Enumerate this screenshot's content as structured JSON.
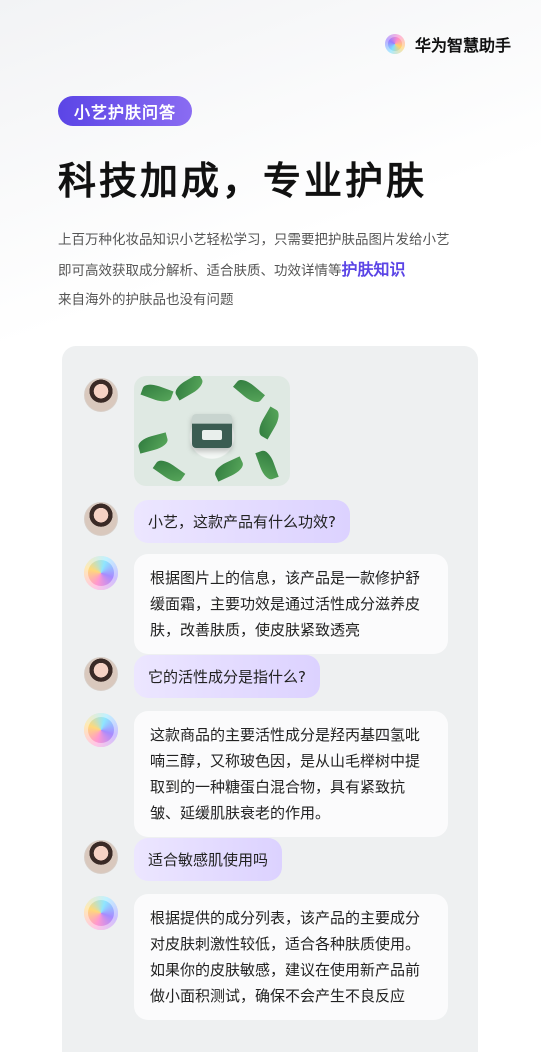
{
  "brand": {
    "name": "华为智慧助手",
    "icon": "huawei-assistant-logo-icon"
  },
  "tag": "小艺护肤问答",
  "headline": "科技加成，专业护肤",
  "description": {
    "line1": "上百万种化妆品知识小艺轻松学习，只需要把护肤品图片发给小艺",
    "line2_prefix": "即可高效获取成分解析、适合肤质、功效详情等",
    "line2_highlight": "护肤知识",
    "line3": "来自海外的护肤品也没有问题"
  },
  "chat": {
    "messages": [
      {
        "role": "user",
        "type": "image",
        "image_desc_icon": "skincare-jar-with-leaves-image"
      },
      {
        "role": "user",
        "type": "text",
        "text": "小艺，这款产品有什么功效?"
      },
      {
        "role": "assistant",
        "type": "text",
        "text": "根据图片上的信息，该产品是一款修护舒缓面霜，主要功效是通过活性成分滋养皮肤，改善肤质，使皮肤紧致透亮"
      },
      {
        "role": "user",
        "type": "text",
        "text": "它的活性成分是指什么?"
      },
      {
        "role": "assistant",
        "type": "text",
        "text": "这款商品的主要活性成分是羟丙基四氢吡喃三醇，又称玻色因，是从山毛榉树中提取到的一种糖蛋白混合物，具有紧致抗皱、延缓肌肤衰老的作用。"
      },
      {
        "role": "user",
        "type": "text",
        "text": "适合敏感肌使用吗"
      },
      {
        "role": "assistant",
        "type": "text",
        "text": "根据提供的成分列表，该产品的主要成分对皮肤刺激性较低，适合各种肤质使用。如果你的皮肤敏感，建议在使用新产品前做小面积测试，确保不会产生不良反应"
      }
    ]
  },
  "colors": {
    "accent": "#5b45e6",
    "question_bubble": "#e3dbff",
    "card_bg": "#eef0f1"
  }
}
